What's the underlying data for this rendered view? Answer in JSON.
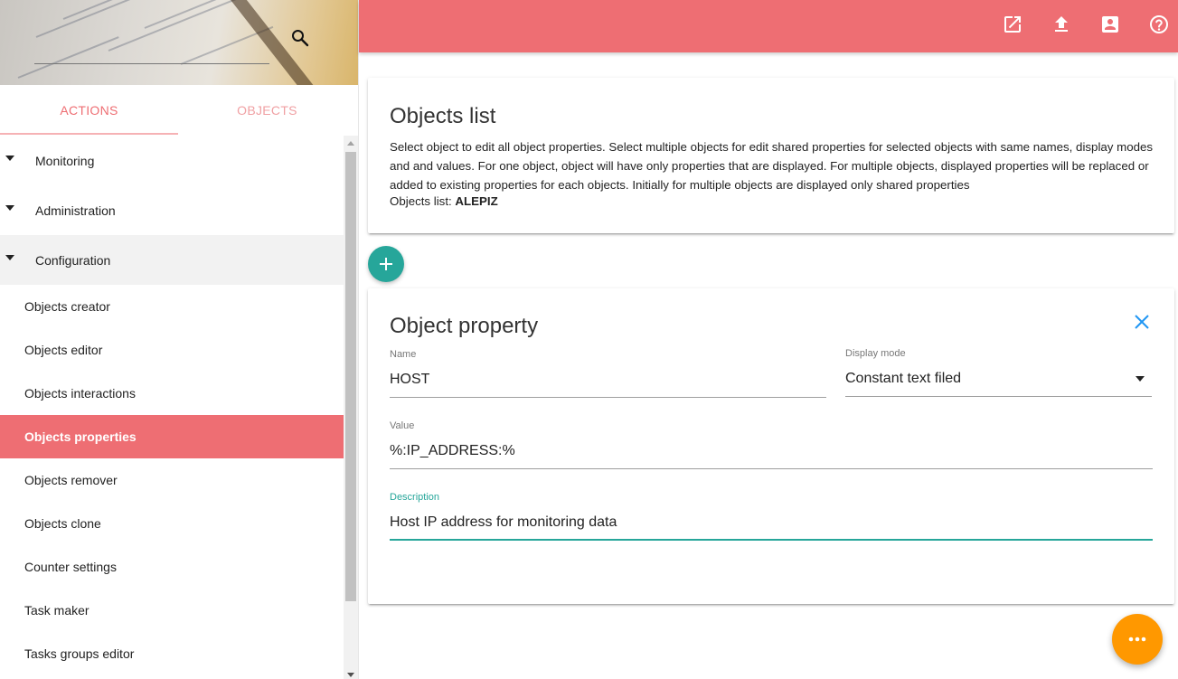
{
  "sidebar": {
    "tabs": [
      {
        "label": "ACTIONS"
      },
      {
        "label": "OBJECTS"
      }
    ],
    "groups": [
      {
        "label": "Monitoring"
      },
      {
        "label": "Administration"
      },
      {
        "label": "Configuration"
      }
    ],
    "items": [
      {
        "label": "Objects creator"
      },
      {
        "label": "Objects editor"
      },
      {
        "label": "Objects interactions"
      },
      {
        "label": "Objects properties"
      },
      {
        "label": "Objects remover"
      },
      {
        "label": "Objects clone"
      },
      {
        "label": "Counter settings"
      },
      {
        "label": "Task maker"
      },
      {
        "label": "Tasks groups editor"
      }
    ],
    "selected_item": "Objects properties",
    "search_icon": "search-icon"
  },
  "topbar": {
    "color": "#ee6e73",
    "icons": [
      "open-in-new-icon",
      "upload-icon",
      "account-box-icon",
      "help-icon"
    ]
  },
  "objects_list": {
    "title": "Objects list",
    "description": "Select object to edit all object properties. Select multiple objects for edit shared properties for selected objects with same names, display modes and and values. For one object, object will have only properties that are displayed. For multiple objects, displayed properties will be replaced or added to existing properties for each objects. Initially for multiple objects are displayed only shared properties",
    "list_label": "Objects list:",
    "list_value": "ALEPIZ"
  },
  "object_property": {
    "title": "Object property",
    "name_label": "Name",
    "name_value": "HOST",
    "display_mode_label": "Display mode",
    "display_mode_value": "Constant text filed",
    "value_label": "Value",
    "value_value": "%:IP_ADDRESS:%",
    "description_label": "Description",
    "description_value": "Host IP address for monitoring data"
  },
  "colors": {
    "accent": "#ee6e73",
    "teal": "#26a69a",
    "orange": "#ff9800"
  }
}
